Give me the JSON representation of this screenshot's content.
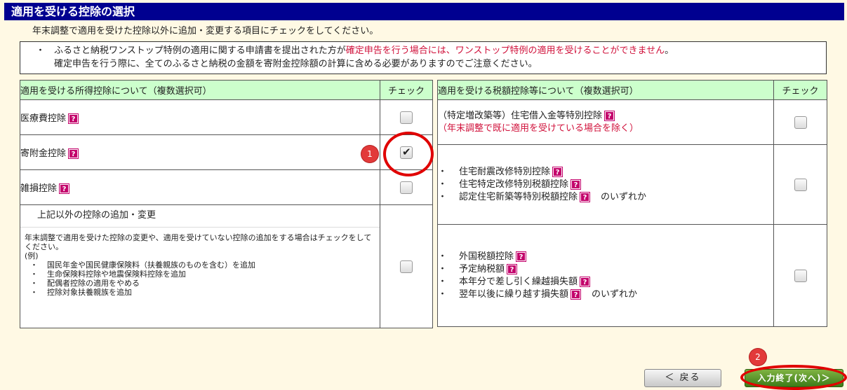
{
  "page": {
    "title": "適用を受ける控除の選択",
    "subtitle": "年末調整で適用を受けた控除以外に追加・変更する項目にチェックをしてください。"
  },
  "notice": {
    "bullet": "・",
    "line1_black": "ふるさと納税ワンストップ特例の適用に関する申請書を提出された方が",
    "line1_red": "確定申告を行う場合には、ワンストップ特例の適用を受けることができません",
    "line1_end": "。",
    "line2": "確定申告を行う際に、全てのふるさと納税の金額を寄附金控除額の計算に含める必要がありますのでご注意ください。"
  },
  "left_table": {
    "header_label": "適用を受ける所得控除について（複数選択可）",
    "header_check": "チェック",
    "rows": [
      {
        "label": "医療費控除",
        "checked": false
      },
      {
        "label": "寄附金控除",
        "checked": true
      },
      {
        "label": "雑損控除",
        "checked": false
      }
    ],
    "other": {
      "label": "上記以外の控除の追加・変更",
      "note": "年末調整で適用を受けた控除の変更や、適用を受けていない控除の追加をする場合はチェックをしてください。",
      "example_label": "(例)",
      "examples": [
        "国民年金や国民健康保険料（扶養親族のものを含む）を追加",
        "生命保険料控除や地震保険料控除を追加",
        "配偶者控除の適用をやめる",
        "控除対象扶養親族を追加"
      ],
      "checked": false
    }
  },
  "right_table": {
    "header_label": "適用を受ける税額控除等について（複数選択可）",
    "header_check": "チェック",
    "row1": {
      "label": "（特定増改築等）住宅借入金等特別控除",
      "note": "（年末調整で既に適用を受けている場合を除く）",
      "checked": false
    },
    "row2": {
      "items": [
        "住宅耐震改修特別控除",
        "住宅特定改修特別税額控除",
        "認定住宅新築等特別税額控除"
      ],
      "suffix": "のいずれか",
      "checked": false
    },
    "row3": {
      "items": [
        "外国税額控除",
        "予定納税額",
        "本年分で差し引く繰越損失額",
        "翌年以後に繰り越す損失額"
      ],
      "suffix": "のいずれか",
      "checked": false
    }
  },
  "bullet_char": "・",
  "help_glyph": "?",
  "check_glyph": "✔",
  "annotations": {
    "badge1": "1",
    "badge2": "2"
  },
  "buttons": {
    "back": "＜ 戻る",
    "next": "入力終了(次へ)＞"
  },
  "colors": {
    "title_bar": "#000090",
    "header_green": "#ccffcc",
    "help_icon": "#c3006b",
    "warning_red": "#d0103a",
    "annotation_red": "#e00000",
    "next_button": "#3d7c19"
  }
}
